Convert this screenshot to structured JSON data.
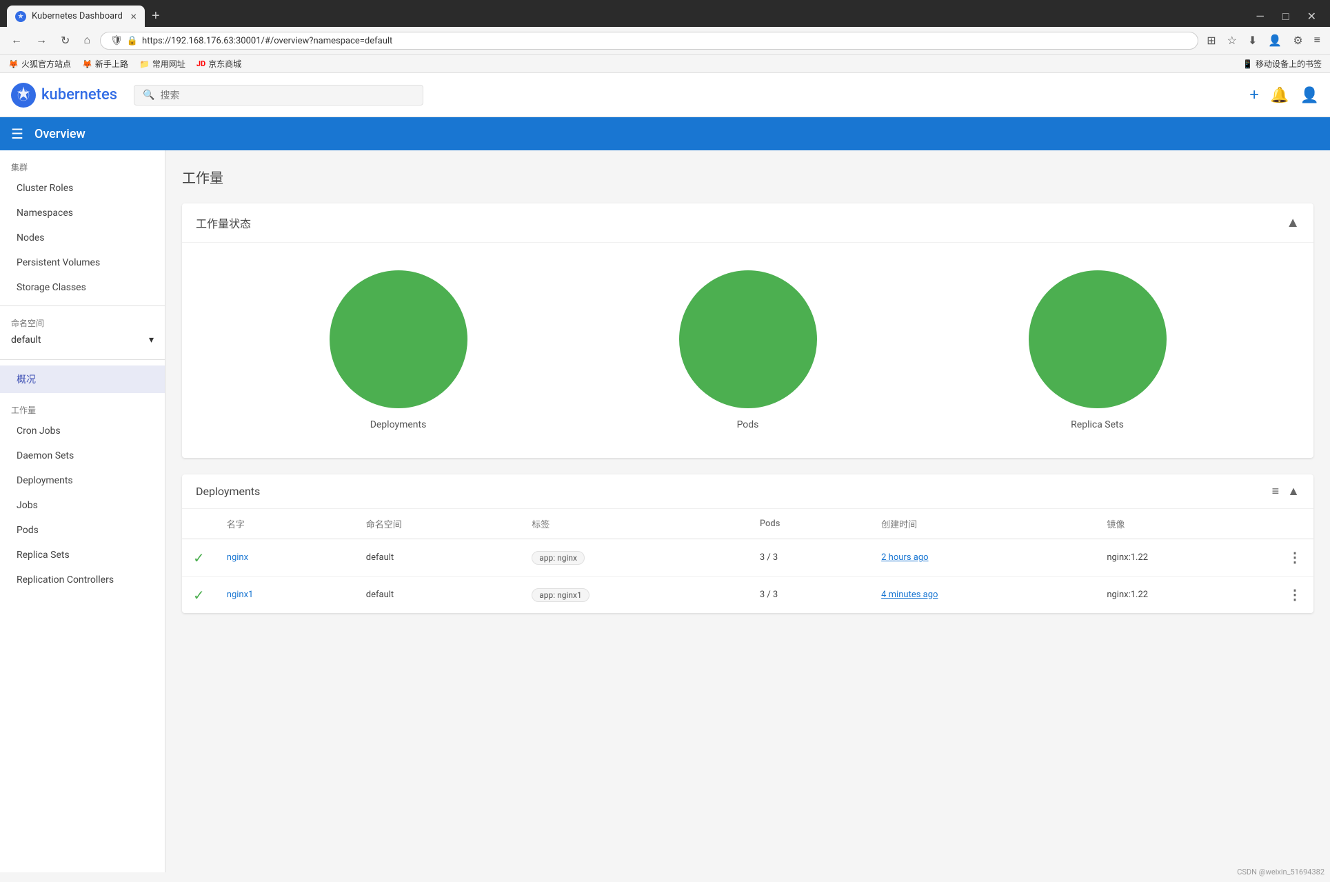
{
  "browser": {
    "tab_title": "Kubernetes Dashboard",
    "tab_close": "×",
    "new_tab": "+",
    "url": "https://192.168.176.63:30001/#/overview?namespace=default",
    "url_secure": "🔒",
    "nav_back": "←",
    "nav_forward": "→",
    "nav_refresh": "↻",
    "nav_home": "⌂",
    "bookmarks": [
      "火狐官方站点",
      "新手上路",
      "常用网址",
      "京东商城"
    ],
    "mobile_bookmark": "移动设备上的书签",
    "minimize": "—",
    "maximize": "□",
    "close": "✕",
    "menu_dots": "≡"
  },
  "header": {
    "logo_text": "kubernetes",
    "search_placeholder": "搜索",
    "add_label": "+",
    "bell_label": "🔔",
    "user_label": "👤"
  },
  "page_header": {
    "menu_icon": "☰",
    "title": "Overview"
  },
  "sidebar": {
    "cluster_section": "集群",
    "cluster_items": [
      {
        "id": "cluster-roles",
        "label": "Cluster Roles"
      },
      {
        "id": "namespaces",
        "label": "Namespaces"
      },
      {
        "id": "nodes",
        "label": "Nodes"
      },
      {
        "id": "persistent-volumes",
        "label": "Persistent Volumes"
      },
      {
        "id": "storage-classes",
        "label": "Storage Classes"
      }
    ],
    "namespace_section": "命名空间",
    "namespace_value": "default",
    "namespace_arrow": "▾",
    "active_item": "概况",
    "workload_section": "工作量",
    "workload_items": [
      {
        "id": "cron-jobs",
        "label": "Cron Jobs"
      },
      {
        "id": "daemon-sets",
        "label": "Daemon Sets"
      },
      {
        "id": "deployments",
        "label": "Deployments"
      },
      {
        "id": "jobs",
        "label": "Jobs"
      },
      {
        "id": "pods",
        "label": "Pods"
      },
      {
        "id": "replica-sets",
        "label": "Replica Sets"
      },
      {
        "id": "replication-controllers",
        "label": "Replication Controllers"
      }
    ]
  },
  "content": {
    "title": "工作量",
    "workload_status_title": "工作量状态",
    "collapse_icon": "▲",
    "circles": [
      {
        "id": "deployments",
        "label": "Deployments",
        "size": 200
      },
      {
        "id": "pods",
        "label": "Pods",
        "size": 200
      },
      {
        "id": "replica-sets",
        "label": "Replica Sets",
        "size": 200
      }
    ],
    "deployments_title": "Deployments",
    "table_columns": [
      "名字",
      "命名空间",
      "标签",
      "Pods",
      "创建时间",
      "镜像"
    ],
    "filter_icon": "≡",
    "collapse_icon2": "▲",
    "rows": [
      {
        "status": "✓",
        "name": "nginx",
        "namespace": "default",
        "label": "app: nginx",
        "pods": "3 / 3",
        "created": "2 hours ago",
        "image": "nginx:1.22"
      },
      {
        "status": "✓",
        "name": "nginx1",
        "namespace": "default",
        "label": "app: nginx1",
        "pods": "3 / 3",
        "created": "4 minutes ago",
        "image": "nginx:1.22"
      }
    ]
  },
  "watermark": "CSDN @weixin_51694382"
}
